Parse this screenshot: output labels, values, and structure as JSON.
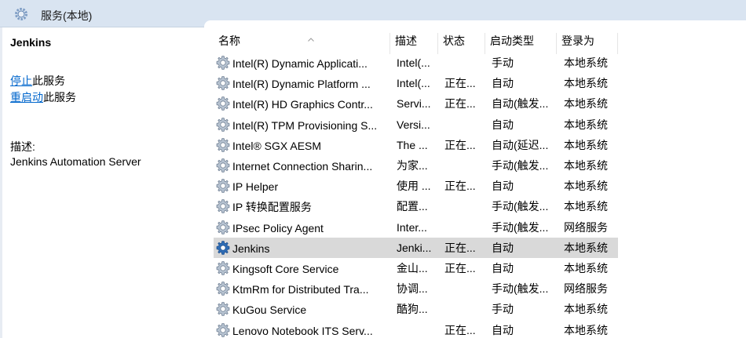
{
  "title": "服务(本地)",
  "left": {
    "service_name": "Jenkins",
    "stop_link": "停止",
    "stop_suffix": "此服务",
    "restart_link": "重启动",
    "restart_suffix": "此服务",
    "desc_label": "描述:",
    "desc_text": "Jenkins Automation Server"
  },
  "columns": {
    "name": "名称",
    "desc": "描述",
    "status": "状态",
    "startup": "启动类型",
    "logon": "登录为"
  },
  "rows": [
    {
      "name": "Intel(R) Dynamic Applicati...",
      "desc": "Intel(...",
      "status": "",
      "startup": "手动",
      "logon": "本地系统"
    },
    {
      "name": "Intel(R) Dynamic Platform ...",
      "desc": "Intel(...",
      "status": "正在...",
      "startup": "自动",
      "logon": "本地系统"
    },
    {
      "name": "Intel(R) HD Graphics Contr...",
      "desc": "Servi...",
      "status": "正在...",
      "startup": "自动(触发...",
      "logon": "本地系统"
    },
    {
      "name": "Intel(R) TPM Provisioning S...",
      "desc": "Versi...",
      "status": "",
      "startup": "自动",
      "logon": "本地系统"
    },
    {
      "name": "Intel® SGX AESM",
      "desc": "The ...",
      "status": "正在...",
      "startup": "自动(延迟...",
      "logon": "本地系统"
    },
    {
      "name": "Internet Connection Sharin...",
      "desc": "为家...",
      "status": "",
      "startup": "手动(触发...",
      "logon": "本地系统"
    },
    {
      "name": "IP Helper",
      "desc": "使用 ...",
      "status": "正在...",
      "startup": "自动",
      "logon": "本地系统"
    },
    {
      "name": "IP 转换配置服务",
      "desc": "配置...",
      "status": "",
      "startup": "手动(触发...",
      "logon": "本地系统"
    },
    {
      "name": "IPsec Policy Agent",
      "desc": "Inter...",
      "status": "",
      "startup": "手动(触发...",
      "logon": "网络服务"
    },
    {
      "name": "Jenkins",
      "desc": "Jenki...",
      "status": "正在...",
      "startup": "自动",
      "logon": "本地系统"
    },
    {
      "name": "Kingsoft Core Service",
      "desc": "金山...",
      "status": "正在...",
      "startup": "自动",
      "logon": "本地系统"
    },
    {
      "name": "KtmRm for Distributed Tra...",
      "desc": "协调...",
      "status": "",
      "startup": "手动(触发...",
      "logon": "网络服务"
    },
    {
      "name": "KuGou Service",
      "desc": "酷狗...",
      "status": "",
      "startup": "手动",
      "logon": "本地系统"
    },
    {
      "name": "Lenovo Notebook ITS Serv...",
      "desc": "",
      "status": "正在...",
      "startup": "自动",
      "logon": "本地系统"
    }
  ],
  "selected_row": 9,
  "colors": {
    "title_bar": "#d9e4f1",
    "link": "#0066cc",
    "selected_row": "#d9d9d9",
    "gear_light": "#b8c4d2",
    "gear_blue": "#2f6db5"
  },
  "icons": {
    "title": "services-icon",
    "row": "gear-icon",
    "selected_row": "gear-blue-icon"
  }
}
